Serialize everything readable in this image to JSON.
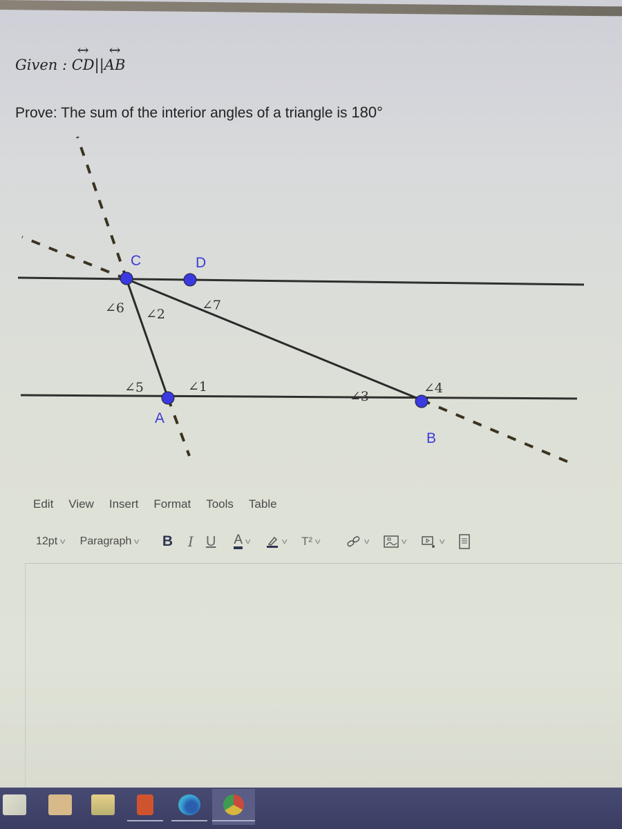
{
  "problem": {
    "given_prefix": "Given : ",
    "line1": "CD",
    "parallel": "||",
    "line2": "AB",
    "prove_text": "Prove: The sum of the interior angles of a triangle is ",
    "prove_value": "180°"
  },
  "figure": {
    "point_color": "#3a3ae0",
    "label_color": "#3b3bd6",
    "points": [
      {
        "id": "C",
        "label": "C"
      },
      {
        "id": "D",
        "label": "D"
      },
      {
        "id": "A",
        "label": "A"
      },
      {
        "id": "B",
        "label": "B"
      }
    ],
    "angles": [
      "∠6",
      "∠2",
      "∠7",
      "∠5",
      "∠1",
      "∠3",
      "∠4"
    ],
    "relation": "CD parallel to AB; triangle ABC with extended sides shown dashed"
  },
  "editor": {
    "menu": [
      "Edit",
      "View",
      "Insert",
      "Format",
      "Tools",
      "Table"
    ],
    "font_size": "12pt",
    "block_format": "Paragraph",
    "buttons": {
      "bold": "B",
      "italic": "I",
      "underline": "U",
      "text_color": "A",
      "superscript": "T²"
    },
    "content": ""
  },
  "taskbar": {
    "apps": [
      "microsoft-store",
      "photos",
      "file-explorer",
      "office",
      "edge",
      "chrome"
    ],
    "color": "#41446b"
  }
}
